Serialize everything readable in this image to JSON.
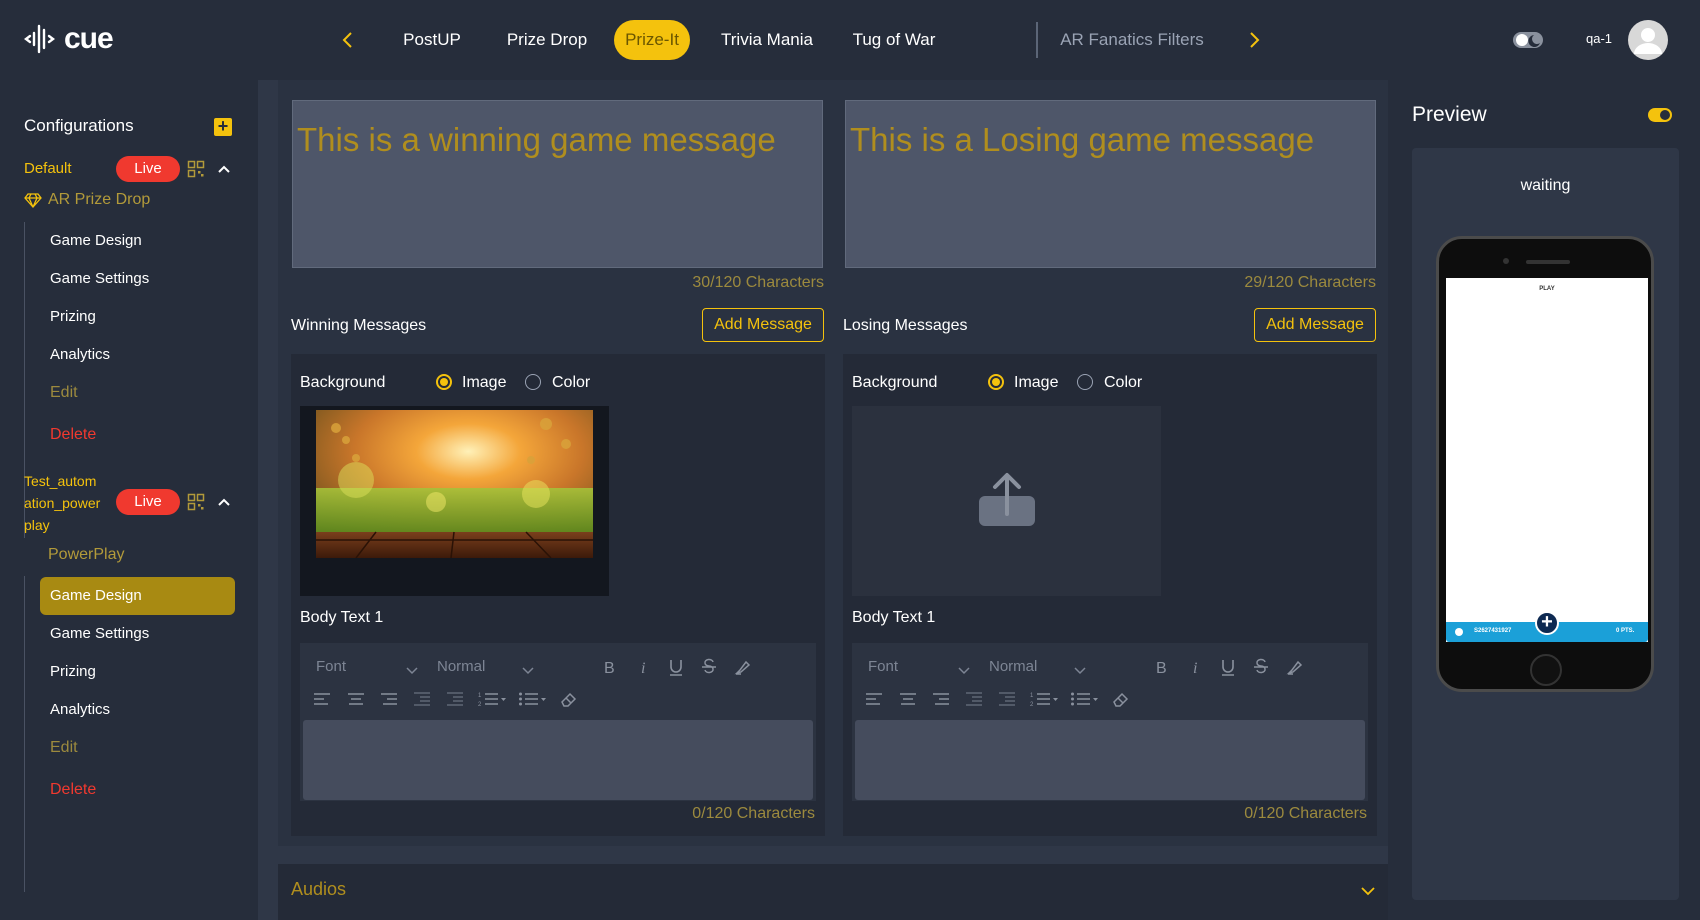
{
  "header": {
    "logo": "cue",
    "tabs": [
      {
        "label": "PostUP"
      },
      {
        "label": "Prize Drop"
      },
      {
        "label": "Prize-It"
      },
      {
        "label": "Trivia Mania"
      },
      {
        "label": "Tug of War"
      },
      {
        "label": "AR Fanatics Filters"
      }
    ],
    "active_tab": "Prize-It",
    "user": "qa-1"
  },
  "sidebar": {
    "title": "Configurations",
    "configs": [
      {
        "name": "Default",
        "status": "Live",
        "game_type": "AR Prize Drop",
        "items": [
          "Game Design",
          "Game Settings",
          "Prizing",
          "Analytics",
          "Edit",
          "Delete"
        ]
      },
      {
        "name_lines": [
          "Test_autom",
          "ation_power",
          "play"
        ],
        "status": "Live",
        "game_type": "PowerPlay",
        "items": [
          "Game Design",
          "Game Settings",
          "Prizing",
          "Analytics",
          "Edit",
          "Delete"
        ],
        "active_item": "Game Design"
      }
    ]
  },
  "main": {
    "winning": {
      "message": "This is a winning game message",
      "count": "30/120 Characters",
      "section_label": "Winning Messages",
      "add_label": "Add Message",
      "background_label": "Background",
      "option_image": "Image",
      "option_color": "Color",
      "selected": "Image",
      "body_label": "Body Text 1",
      "font_label": "Font",
      "size_label": "Normal",
      "body_count": "0/120 Characters"
    },
    "losing": {
      "message": "This is a Losing game message",
      "count": "29/120 Characters",
      "section_label": "Losing Messages",
      "add_label": "Add Message",
      "background_label": "Background",
      "option_image": "Image",
      "option_color": "Color",
      "selected": "Image",
      "body_label": "Body Text 1",
      "font_label": "Font",
      "size_label": "Normal",
      "body_count": "0/120 Characters"
    },
    "audios_label": "Audios"
  },
  "preview": {
    "title": "Preview",
    "status": "waiting",
    "screen_title": "PLAY",
    "bar_left": "S2627431927",
    "bar_right": "0 PTS."
  },
  "colors": {
    "accent": "#f4c20d",
    "live": "#f0392f",
    "background": "#262d3b"
  }
}
